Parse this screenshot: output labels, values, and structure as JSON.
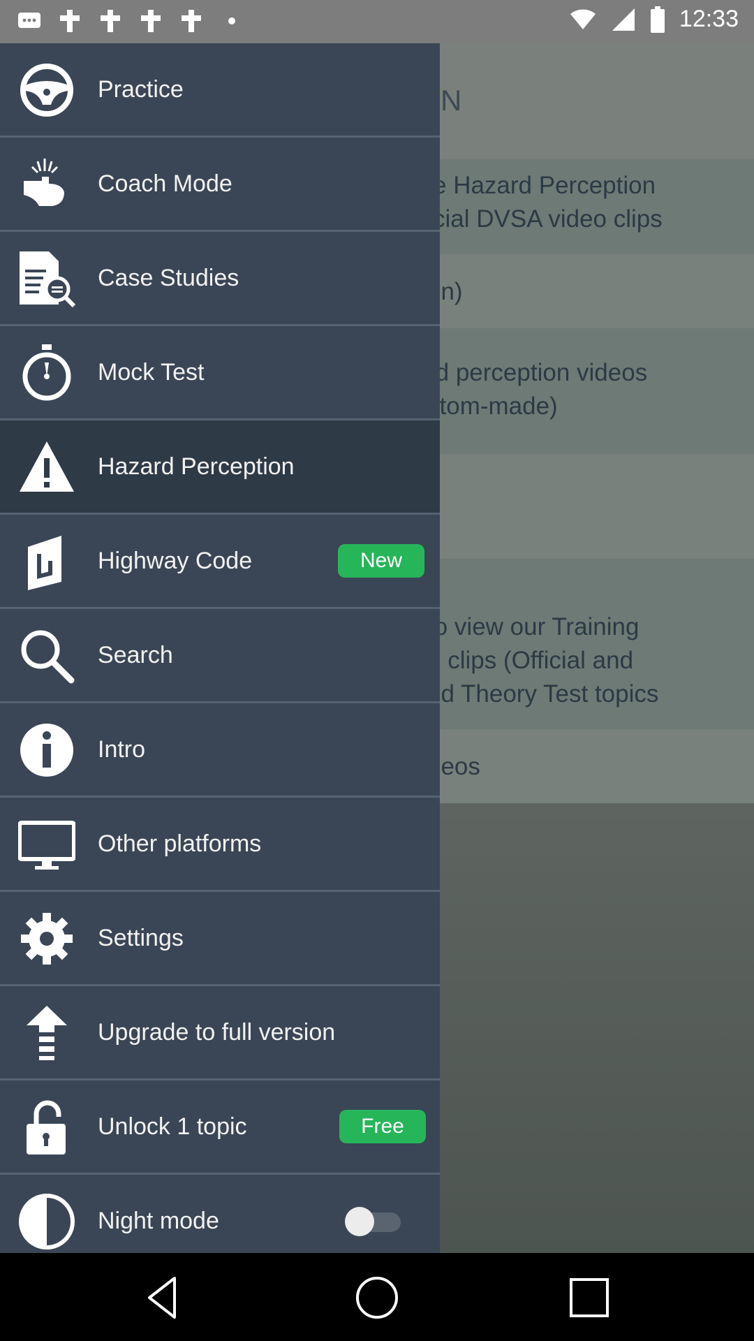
{
  "status_bar": {
    "time": "12:33",
    "left_icons": [
      "message-icon",
      "notification-icon",
      "notification-icon",
      "notification-icon",
      "notification-icon",
      "dot-icon"
    ],
    "right_icons": [
      "wifi-icon",
      "signal-icon",
      "battery-icon"
    ]
  },
  "background_screen": {
    "title_fragment": "EPTION",
    "rows": [
      {
        "line1": "e Hazard Perception",
        "line2": "cial DVSA video clips"
      },
      {
        "line1": "on)",
        "line2": ""
      },
      {
        "line1": "rd perception videos",
        "line2": "stom-made)"
      },
      {
        "line1": "",
        "line2": ""
      },
      {
        "line1": "to view our Training",
        "line2": "o clips (Official and",
        "line3": "ed Theory Test topics"
      },
      {
        "line1": "deos",
        "line2": ""
      }
    ]
  },
  "drawer": {
    "items": [
      {
        "label": "Practice",
        "icon": "steering-wheel-icon"
      },
      {
        "label": "Coach Mode",
        "icon": "touch-hand-icon"
      },
      {
        "label": "Case Studies",
        "icon": "document-search-icon"
      },
      {
        "label": "Mock Test",
        "icon": "stopwatch-icon"
      },
      {
        "label": "Hazard Perception",
        "icon": "warning-icon",
        "selected": true
      },
      {
        "label": "Highway Code",
        "icon": "road-book-icon",
        "badge": "New"
      },
      {
        "label": "Search",
        "icon": "search-icon"
      },
      {
        "label": "Intro",
        "icon": "info-icon"
      },
      {
        "label": "Other platforms",
        "icon": "monitor-icon"
      },
      {
        "label": "Settings",
        "icon": "gear-icon"
      },
      {
        "label": "Upgrade to full version",
        "icon": "upgrade-arrow-icon"
      },
      {
        "label": "Unlock 1 topic",
        "icon": "unlock-icon",
        "badge": "Free"
      },
      {
        "label": "Night mode",
        "icon": "half-circle-icon",
        "toggle_on": false
      }
    ]
  },
  "colors": {
    "drawer_bg": "#3a4655",
    "selected_bg": "#2f3a47",
    "badge_green": "#27b55a"
  },
  "nav_bar": {
    "buttons": [
      "back-icon",
      "home-icon",
      "recents-icon"
    ]
  }
}
